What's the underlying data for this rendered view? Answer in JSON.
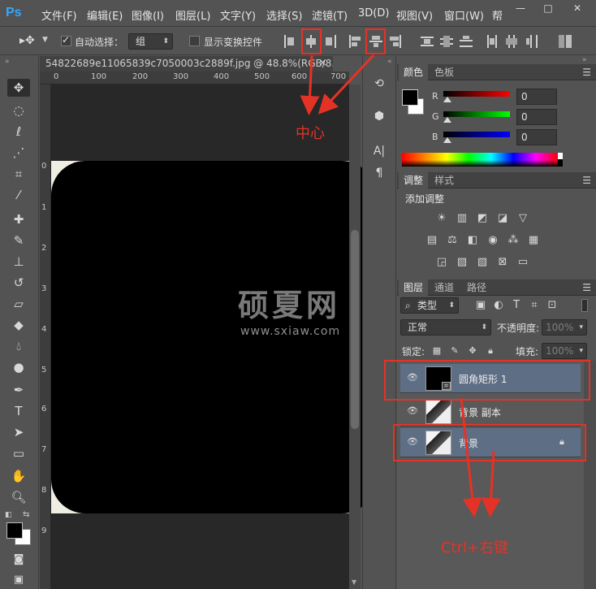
{
  "app": {
    "logo": "Ps"
  },
  "menubar": {
    "items": [
      "文件(F)",
      "编辑(E)",
      "图像(I)",
      "图层(L)",
      "文字(Y)",
      "选择(S)",
      "滤镜(T)",
      "3D(D)",
      "视图(V)",
      "窗口(W)",
      "帮"
    ]
  },
  "window_controls": {
    "minimize": "—",
    "maximize": "□",
    "close": "✕"
  },
  "options_bar": {
    "auto_select_label": "自动选择：",
    "auto_select_value": "组",
    "show_transform_label": "显示变换控件"
  },
  "document": {
    "tab_title": "54822689e11065839c7050003c2889f.jpg @ 48.8%(RGB/8...",
    "close": "×",
    "ruler_top_ticks": [
      "0",
      "100",
      "200",
      "300",
      "400",
      "500",
      "600",
      "700"
    ],
    "ruler_left_ticks": [
      "0",
      "1",
      "2",
      "3",
      "4",
      "5",
      "6",
      "7",
      "8",
      "9"
    ]
  },
  "watermark": {
    "text": "硕夏网",
    "url": "www.sxiaw.com"
  },
  "color_panel": {
    "tabs": [
      "颜色",
      "色板"
    ],
    "channels": [
      {
        "label": "R",
        "value": "0",
        "color": "#e03030"
      },
      {
        "label": "G",
        "value": "0",
        "color": "#30b030"
      },
      {
        "label": "B",
        "value": "0",
        "color": "#3050e0"
      }
    ]
  },
  "adjustments_panel": {
    "tabs": [
      "调整",
      "样式"
    ],
    "title": "添加调整"
  },
  "layers_panel": {
    "tabs": [
      "图层",
      "通道",
      "路径"
    ],
    "filter_label": "类型",
    "blend_mode": "正常",
    "opacity_label": "不透明度:",
    "opacity_value": "100%",
    "lock_label": "锁定:",
    "fill_label": "填充:",
    "fill_value": "100%",
    "layers": [
      {
        "name": "圆角矩形 1",
        "selected": true
      },
      {
        "name": "背景 副本",
        "selected": false
      },
      {
        "name": "背景",
        "selected": true
      }
    ]
  },
  "annotations": {
    "center": "中心",
    "ctrl_right": "Ctrl+右键"
  }
}
